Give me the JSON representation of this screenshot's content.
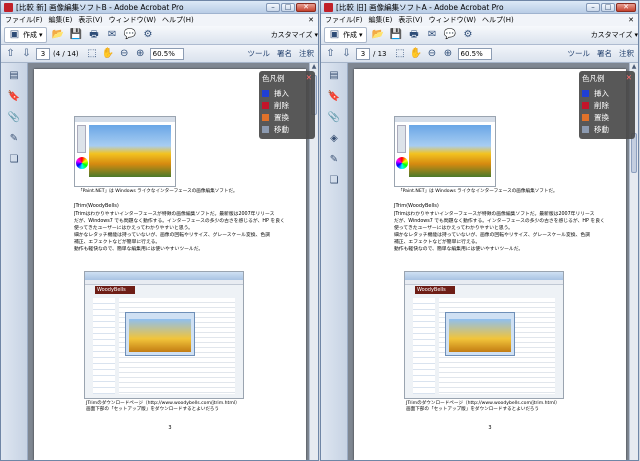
{
  "windows": [
    {
      "id": "left",
      "title": "[比較 新] 画像編集ソフトB - Adobe Acrobat Pro",
      "menus": [
        "ファイル(F)",
        "編集(E)",
        "表示(V)",
        "ウィンドウ(W)",
        "ヘルプ(H)"
      ],
      "create_label": "作成",
      "customize_label": "カスタマイズ",
      "page_value": "3",
      "page_total": "(4 / 14)",
      "zoom_value": "60.5%",
      "nav_links": [
        "ツール",
        "署名",
        "注釈"
      ],
      "page_number": "3"
    },
    {
      "id": "right",
      "title": "[比較 旧] 画像編集ソフトA - Adobe Acrobat Pro",
      "menus": [
        "ファイル(F)",
        "編集(E)",
        "表示(V)",
        "ウィンドウ(W)",
        "ヘルプ(H)"
      ],
      "create_label": "作成",
      "customize_label": "カスタマイズ",
      "page_value": "3",
      "page_total": "/ 13",
      "zoom_value": "60.5%",
      "nav_links": [
        "ツール",
        "署名",
        "注釈"
      ],
      "page_number": "3"
    }
  ],
  "document": {
    "caption1": "「Paint.NET」は Windows ライクなインターフェースの画像編集ソフトだ。",
    "heading": "JTrim(WoodyBells)",
    "paragraph": [
      "JTrimはわかりやすいインターフェースが特徴の画像編集ソフトだ。最新版は2007年リリース",
      "だが、Windows7 でも問題なく動作する。インターフェースの多少の古さを感じるが、HP を良く",
      "使ってきたユーザーにはかえってわかりやすいと思う。",
      "細かなレタッチ機能は持っていないが、画像の回転やリサイズ、グレースケール変換、色調",
      "補正、エフェクトなどが簡単に行える。",
      "動作も軽快なので、簡単な編集用には使いやすいツールだ。"
    ],
    "screenshot_logo": "WoodyBells",
    "caption2_line1": "JTrimのダウンロードページ（http://www.woodybells.com/jtrim.html）",
    "caption2_line2": "画面下部の「セットアップ版」をダウンロードするとよいだろう"
  },
  "legend": {
    "title": "色凡例",
    "close": "✕",
    "items": [
      {
        "label": "挿入",
        "color": "#1f3fd6"
      },
      {
        "label": "削除",
        "color": "#c4142a"
      },
      {
        "label": "置換",
        "color": "#e0722a"
      },
      {
        "label": "移動",
        "color": "#8c9ab0"
      }
    ]
  },
  "icons": {
    "toolbar": [
      "create-icon",
      "open-icon",
      "save-icon",
      "print-icon",
      "mail-icon",
      "comment-icon",
      "gear-icon"
    ],
    "nav": [
      "up-arrow-icon",
      "down-arrow-icon",
      "select-icon",
      "hand-icon",
      "zoom-out-icon",
      "zoom-in-icon"
    ],
    "left_panel": [
      "page-thumb-icon",
      "bookmark-icon",
      "clip-icon",
      "layers-icon",
      "signature-icon"
    ]
  }
}
